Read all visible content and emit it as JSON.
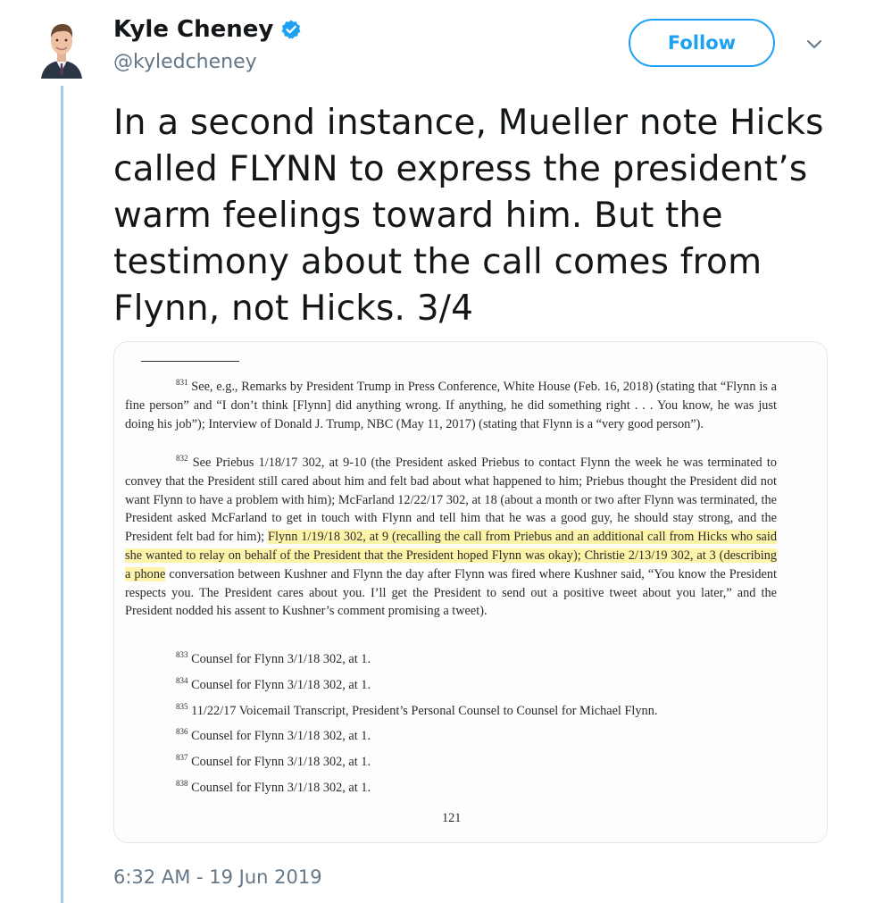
{
  "author": {
    "name": "Kyle Cheney",
    "handle": "@kyledcheney",
    "verified_icon": "verified-badge-icon",
    "avatar_icon": "profile-photo"
  },
  "actions": {
    "follow_label": "Follow",
    "more_icon": "chevron-down-icon"
  },
  "tweet": {
    "text": "In a second instance, Mueller note Hicks called FLYNN to express the president’s warm feelings toward him. But the testimony about the call comes from Flynn, not Hicks. 3/4",
    "timestamp": "6:32 AM - 19 Jun 2019"
  },
  "document": {
    "fn831_num": "831",
    "fn831_text": "See, e.g., Remarks by President Trump in Press Conference, White House (Feb. 16, 2018) (stating that “Flynn is a fine person” and “I don’t think [Flynn] did anything wrong. If anything, he did something right . . . You know, he was just doing his job”); Interview of Donald J. Trump, NBC (May 11, 2017) (stating that Flynn is a “very good person”).",
    "fn832_num": "832",
    "fn832_text_a": "See Priebus 1/18/17 302, at 9-10 (the President asked Priebus to contact Flynn the week he was terminated to convey that the President still cared about him and felt bad about what happened to him; Priebus thought the President did not want Flynn to have a problem with him); McFarland 12/22/17 302, at 18 (about a month or two after Flynn was terminated, the President asked McFarland to get in touch with Flynn and tell him that he was a good guy, he should stay strong, and the President felt bad for him); ",
    "fn832_text_hl": "Flynn 1/19/18 302, at 9 (recalling the call from Priebus and an additional call from Hicks who said she wanted to relay on behalf of the President that the President hoped Flynn was okay); Christie 2/13/19 302, at 3 (describing a phone",
    "fn832_text_b": " conversation between Kushner and Flynn the day after Flynn was fired where Kushner said, “You know the President respects you. The President cares about you. I’ll get the President to send out a positive tweet about you later,” and the President nodded his assent to Kushner’s comment promising a tweet).",
    "short_notes": [
      {
        "num": "833",
        "text": "Counsel for Flynn 3/1/18 302, at 1."
      },
      {
        "num": "834",
        "text": "Counsel for Flynn 3/1/18 302, at 1."
      },
      {
        "num": "835",
        "text": "11/22/17 Voicemail Transcript, President’s Personal Counsel to Counsel for Michael Flynn."
      },
      {
        "num": "836",
        "text": "Counsel for Flynn 3/1/18 302, at 1."
      },
      {
        "num": "837",
        "text": "Counsel for Flynn 3/1/18 302, at 1."
      },
      {
        "num": "838",
        "text": "Counsel for Flynn 3/1/18 302, at 1."
      }
    ],
    "page_number": "121"
  }
}
